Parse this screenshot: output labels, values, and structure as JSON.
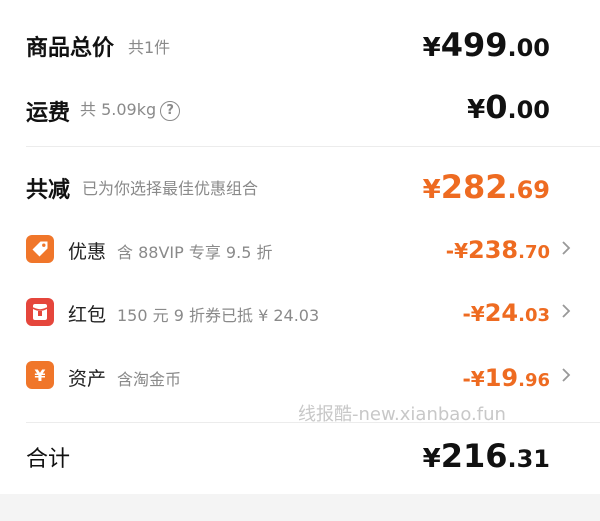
{
  "goods_total": {
    "label": "商品总价",
    "sub": "共1件",
    "currency": "¥",
    "integer": "499",
    "decimal": ".00"
  },
  "shipping": {
    "label": "运费",
    "sub": "共 5.09kg",
    "info_glyph": "?",
    "currency": "¥",
    "integer": "0",
    "decimal": ".00"
  },
  "discount_total": {
    "label": "共减",
    "sub": "已为你选择最佳优惠组合",
    "currency": "¥",
    "integer": "282",
    "decimal": ".69"
  },
  "items": [
    {
      "icon": "tag-icon",
      "icon_color": "#f0762a",
      "label": "优惠",
      "sub": "含 88VIP 专享 9.5 折",
      "prefix": "-¥",
      "integer": "238",
      "decimal": ".70"
    },
    {
      "icon": "red-packet-icon",
      "icon_color": "#e5463c",
      "label": "红包",
      "sub": "150 元 9 折券已抵 ¥ 24.03",
      "prefix": "-¥",
      "integer": "24",
      "decimal": ".03"
    },
    {
      "icon": "coin-icon",
      "icon_color": "#f0762a",
      "label": "资产",
      "sub": "含淘金币",
      "prefix": "-¥",
      "integer": "19",
      "decimal": ".96"
    }
  ],
  "total": {
    "label": "合计",
    "currency": "¥",
    "integer": "216",
    "decimal": ".31"
  },
  "watermark": "线报酷-new.xianbao.fun",
  "colors": {
    "accent_orange": "#ee6b21",
    "text_dark": "#111111",
    "text_muted": "#8a8a8a"
  }
}
